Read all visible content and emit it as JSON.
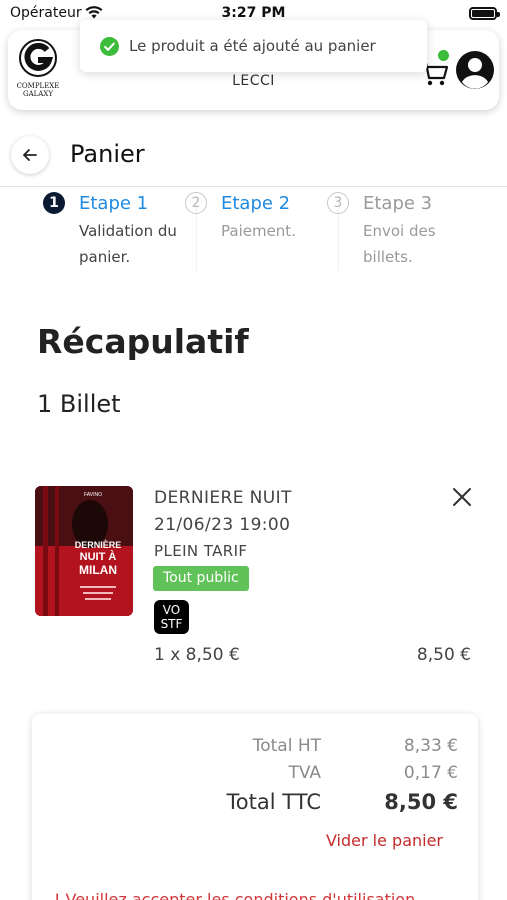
{
  "status_bar": {
    "carrier": "Opérateur",
    "time": "3:27 PM"
  },
  "header": {
    "logo_text_line1": "COMPLEXE",
    "logo_text_line2": "GALAXY",
    "cinema_name": "LECCI",
    "cart_indicator_color": "#3dbb3a"
  },
  "toast": {
    "message": "Le produit a été ajouté au panier",
    "icon": "check-circle-icon",
    "color": "#3dbb3a"
  },
  "page": {
    "title": "Panier"
  },
  "steps": [
    {
      "number": "1",
      "label": "Etape 1",
      "description": "Validation du panier.",
      "state": "active"
    },
    {
      "number": "2",
      "label": "Etape 2",
      "description": "Paiement.",
      "state": "upcoming"
    },
    {
      "number": "3",
      "label": "Etape 3",
      "description": "Envoi des billets.",
      "state": "disabled"
    }
  ],
  "summary": {
    "title": "Récapulatif",
    "ticket_count": "1 Billet"
  },
  "cart_item": {
    "movie_title": "DERNIERE NUIT",
    "datetime": "21/06/23 19:00",
    "rate": "PLEIN TARIF",
    "audience": "Tout public",
    "version_line1": "VO",
    "version_line2": "STF",
    "quantity_price": "1 x 8,50 €",
    "line_total": "8,50 €",
    "poster_text_line1": "DERNIÈRE",
    "poster_text_line2": "NUIT À",
    "poster_text_line3": "MILAN",
    "poster_actor": "FAVINO"
  },
  "totals": {
    "ht_label": "Total HT",
    "ht_value": "8,33 €",
    "tva_label": "TVA",
    "tva_value": "0,17 €",
    "ttc_label": "Total TTC",
    "ttc_value": "8,50 €",
    "clear_cart": "Vider le panier",
    "warning": "! Veuillez accepter les conditions d'utilisation"
  },
  "colors": {
    "accent_blue": "#1f8ae0",
    "step_active_bg": "#0a1a33",
    "danger": "#c42b2b",
    "badge_green": "#62c25a"
  }
}
